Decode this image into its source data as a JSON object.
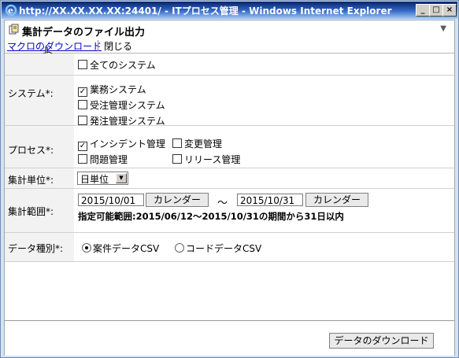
{
  "window": {
    "title": "http://XX.XX.XX.XX:24401/ - ITプロセス管理 - Windows Internet Explorer",
    "min_label": "_",
    "max_label": "□",
    "close_label": "×"
  },
  "header": {
    "title": "集計データのファイル出力"
  },
  "toolbar": {
    "macro_download": "マクロのダウンロード",
    "close": "閉じる"
  },
  "form": {
    "system": {
      "label": "システム*:",
      "all": "全てのシステム",
      "options": [
        {
          "label": "業務システム",
          "checked": true
        },
        {
          "label": "受注管理システム",
          "checked": false
        },
        {
          "label": "発注管理システム",
          "checked": false
        }
      ]
    },
    "process": {
      "label": "プロセス*:",
      "options": [
        {
          "label": "インシデント管理",
          "checked": true
        },
        {
          "label": "変更管理",
          "checked": false
        },
        {
          "label": "問題管理",
          "checked": false
        },
        {
          "label": "リリース管理",
          "checked": false
        }
      ]
    },
    "unit": {
      "label": "集計単位*:",
      "value": "日単位"
    },
    "range": {
      "label": "集計範囲*:",
      "from": "2015/10/01",
      "to": "2015/10/31",
      "calendar": "カレンダー",
      "tilde": "〜",
      "note": "指定可能範囲:2015/06/12〜2015/10/31の期間から31日以内"
    },
    "datatype": {
      "label": "データ種別*:",
      "options": [
        {
          "label": "案件データCSV",
          "selected": true
        },
        {
          "label": "コードデータCSV",
          "selected": false
        }
      ]
    }
  },
  "footer": {
    "download": "データのダウンロード"
  },
  "colors": {
    "title_bar": "#0a246a",
    "link": "#0000cc",
    "label_bg": "#f2f2f2"
  }
}
